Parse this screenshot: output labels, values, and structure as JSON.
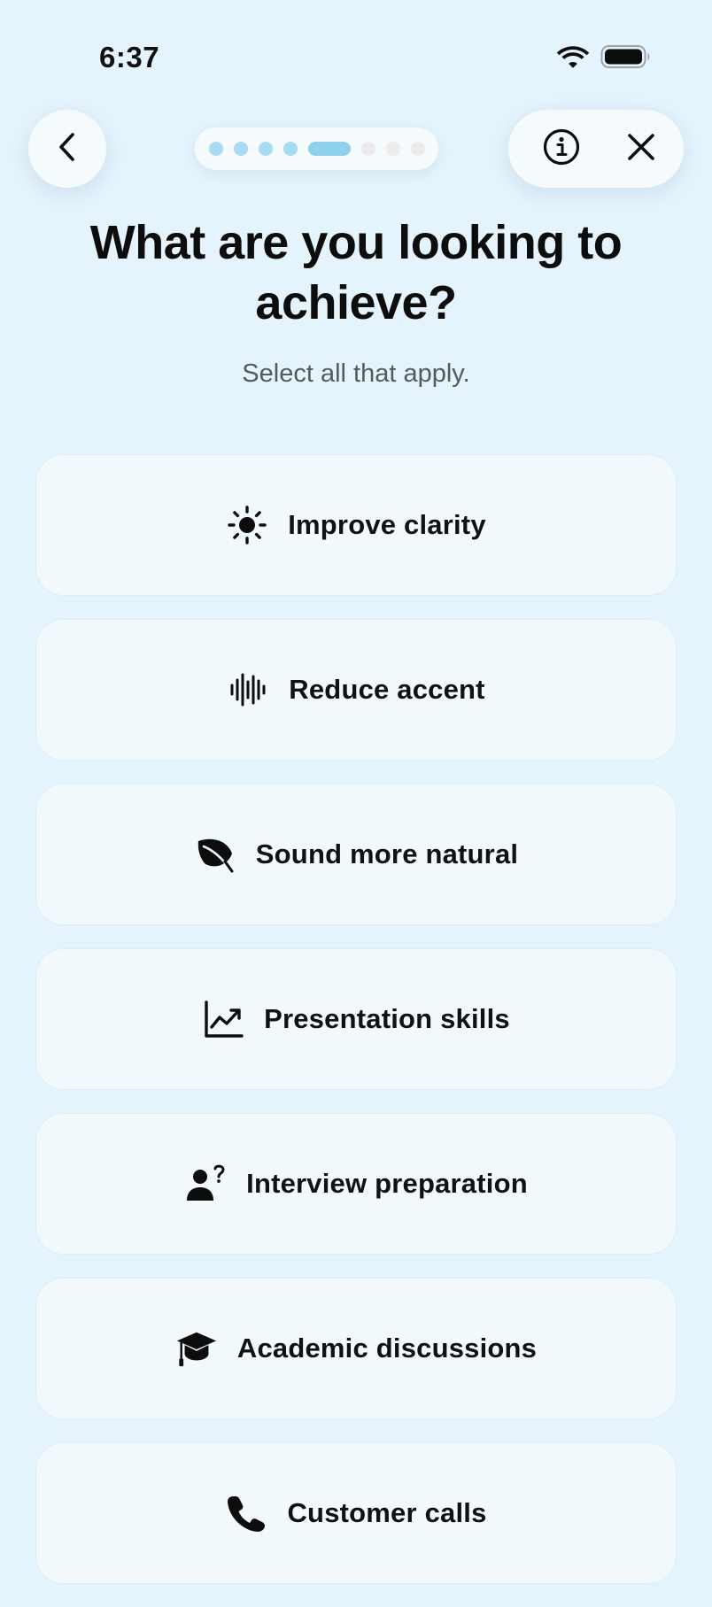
{
  "status_bar": {
    "time": "6:37",
    "wifi_icon": "wifi-icon",
    "battery_icon": "battery-icon"
  },
  "nav": {
    "back_icon": "chevron-left-icon",
    "info_icon": "info-circle-icon",
    "close_icon": "close-icon",
    "progress": {
      "total_steps": 9,
      "current_step": 5,
      "active_color": "#8fd0ec",
      "done_color": "#a9dbf0",
      "todo_color": "#ececec"
    }
  },
  "header": {
    "title": "What are you looking to achieve?",
    "subtitle": "Select all that apply."
  },
  "options": [
    {
      "label": "Improve clarity",
      "icon": "sun-icon"
    },
    {
      "label": "Reduce accent",
      "icon": "waveform-icon"
    },
    {
      "label": "Sound more natural",
      "icon": "leaf-icon"
    },
    {
      "label": "Presentation skills",
      "icon": "chart-line-icon"
    },
    {
      "label": "Interview preparation",
      "icon": "person-question-icon"
    },
    {
      "label": "Academic discussions",
      "icon": "graduation-cap-icon"
    },
    {
      "label": "Customer calls",
      "icon": "phone-icon"
    }
  ],
  "colors": {
    "background": "#e5f3fc",
    "card": "#f2f9fd",
    "text": "#111111",
    "subtitle": "#555a5e"
  }
}
